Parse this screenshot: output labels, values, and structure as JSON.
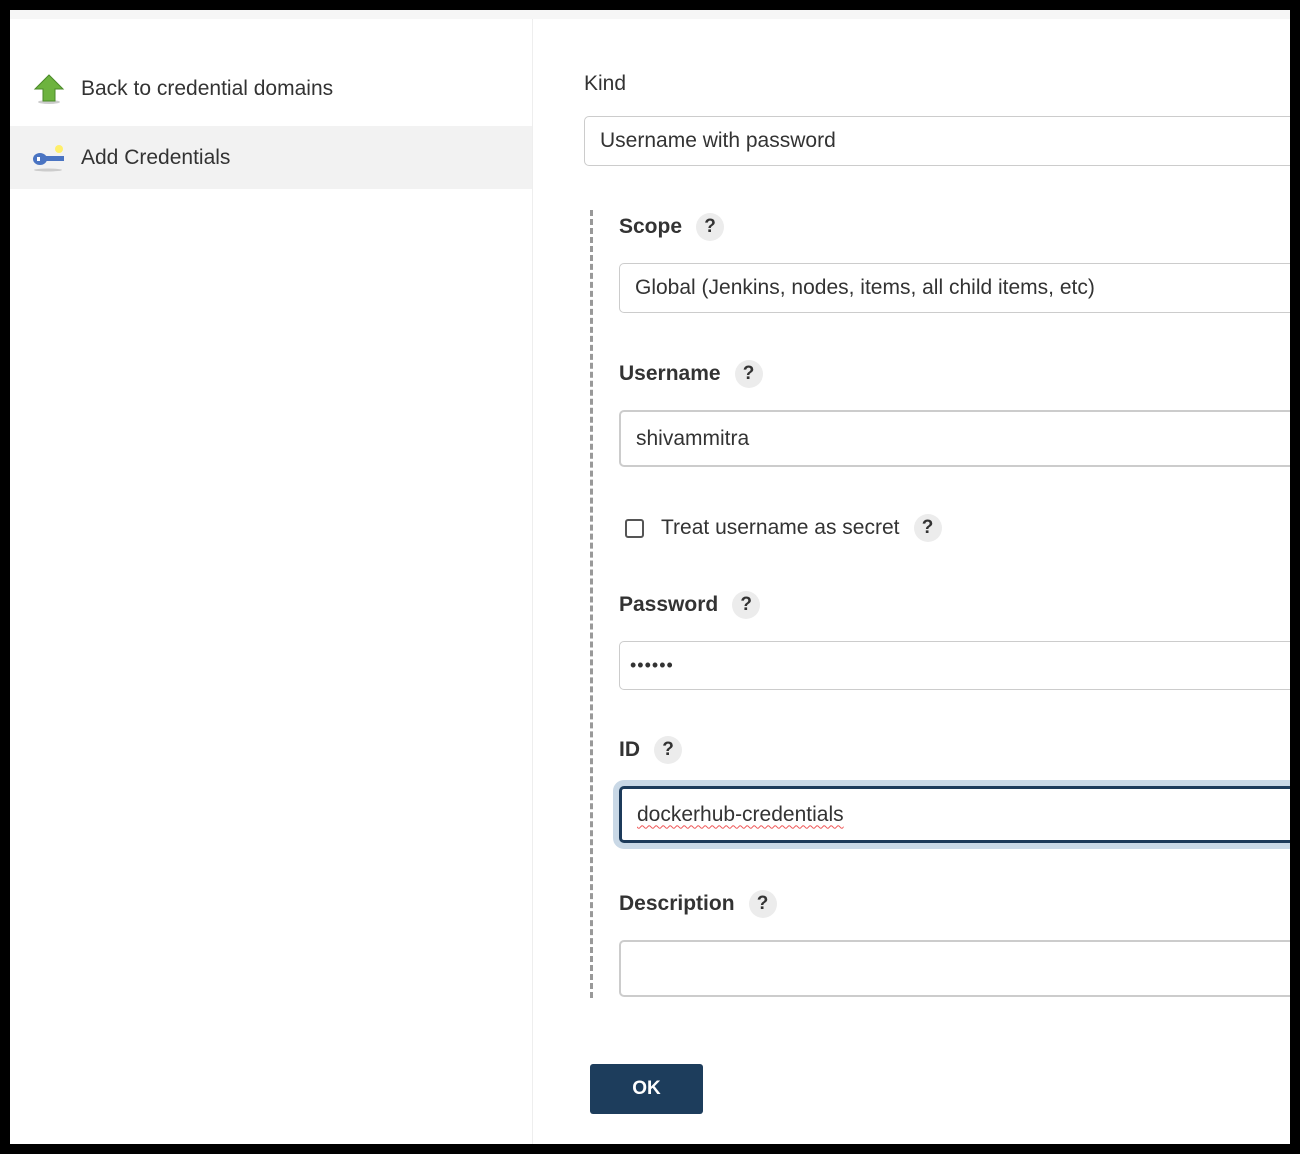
{
  "sidebar": {
    "items": [
      {
        "label": "Back to credential domains",
        "icon": "up-arrow-icon"
      },
      {
        "label": "Add Credentials",
        "icon": "key-icon",
        "active": true
      }
    ]
  },
  "form": {
    "kind": {
      "label": "Kind",
      "value": "Username with password"
    },
    "scope": {
      "label": "Scope",
      "help": "?",
      "value": "Global (Jenkins, nodes, items, all child items, etc)"
    },
    "username": {
      "label": "Username",
      "help": "?",
      "value": "shivammitra"
    },
    "treat_secret": {
      "label": "Treat username as secret",
      "help": "?",
      "checked": false
    },
    "password": {
      "label": "Password",
      "help": "?",
      "value": "••••••"
    },
    "id": {
      "label": "ID",
      "help": "?",
      "value": "dockerhub-credentials"
    },
    "description": {
      "label": "Description",
      "help": "?",
      "value": ""
    },
    "ok_label": "OK"
  },
  "colors": {
    "button": "#1d3d5c",
    "focus_ring": "#c9d8e6",
    "active_sidebar": "#f2f2f2"
  }
}
